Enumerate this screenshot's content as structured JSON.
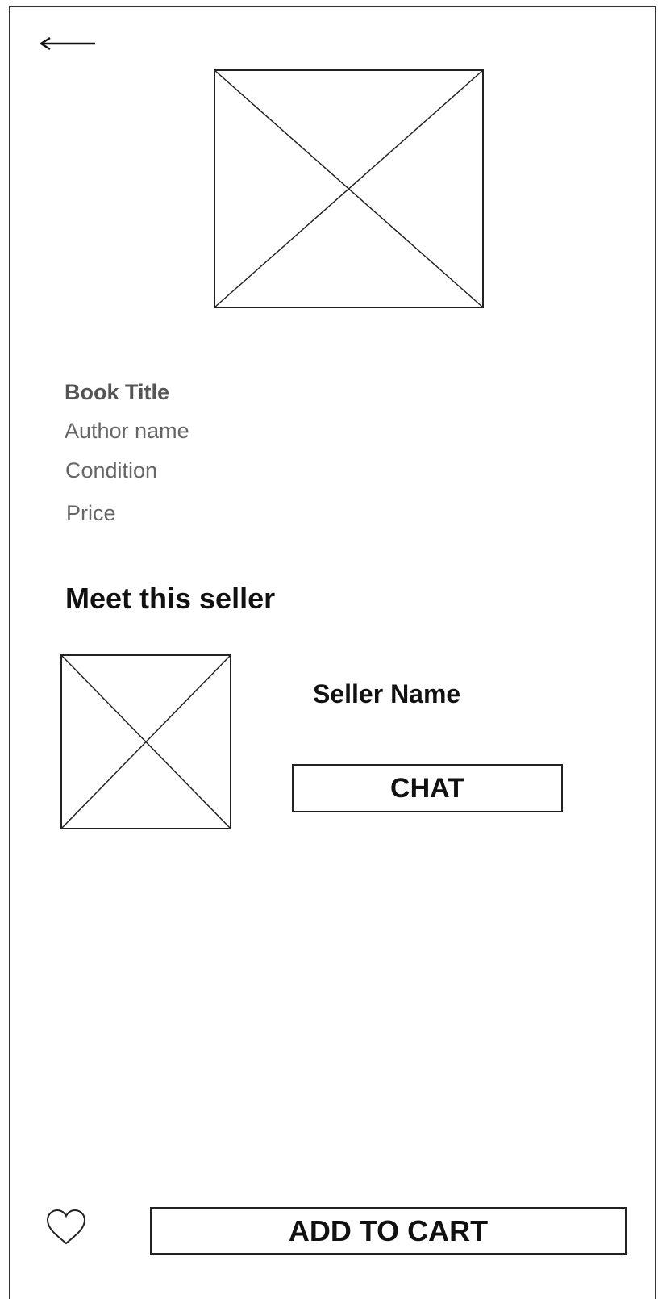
{
  "header": {
    "back_icon": "arrow-left-icon"
  },
  "book": {
    "image_icon": "image-placeholder-icon",
    "title": "Book Title",
    "author": "Author name",
    "condition": "Condition",
    "price": "Price"
  },
  "seller_section": {
    "heading": "Meet this seller",
    "avatar_icon": "image-placeholder-icon",
    "seller_name": "Seller Name",
    "chat_label": "CHAT"
  },
  "footer": {
    "favorite_icon": "heart-icon",
    "add_to_cart_label": "ADD TO CART"
  }
}
